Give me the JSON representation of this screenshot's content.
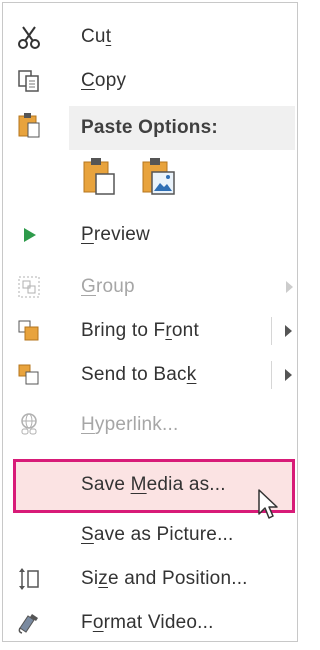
{
  "menu": {
    "items": [
      {
        "pre": "Cu",
        "u": "t",
        "post": "",
        "icon": "scissors-icon",
        "enabled": true
      },
      {
        "pre": "",
        "u": "C",
        "post": "opy",
        "icon": "copy-icon",
        "enabled": true
      },
      {
        "pre": "",
        "u": "P",
        "post": "review",
        "icon": "play-icon",
        "enabled": true
      },
      {
        "pre": "",
        "u": "G",
        "post": "roup",
        "icon": "group-icon",
        "enabled": false
      },
      {
        "pre": "Bring to F",
        "u": "r",
        "post": "ont",
        "icon": "bring-to-front-icon",
        "enabled": true
      },
      {
        "pre": "Send to Bac",
        "u": "k",
        "post": "",
        "icon": "send-to-back-icon",
        "enabled": true
      },
      {
        "pre": "",
        "u": "H",
        "post": "yperlink...",
        "icon": "hyperlink-icon",
        "enabled": false
      },
      {
        "pre": "Save ",
        "u": "M",
        "post": "edia as...",
        "icon": "",
        "enabled": true
      },
      {
        "pre": "",
        "u": "S",
        "post": "ave as Picture...",
        "icon": "",
        "enabled": true
      },
      {
        "pre": "Si",
        "u": "z",
        "post": "e and Position...",
        "icon": "size-position-icon",
        "enabled": true
      },
      {
        "pre": "F",
        "u": "o",
        "post": "rmat Video...",
        "icon": "format-video-icon",
        "enabled": true
      }
    ],
    "paste_header": "Paste Options:",
    "paste_buttons": [
      "paste-keep-source-icon",
      "paste-picture-icon"
    ]
  },
  "colors": {
    "highlight_border": "#d81b78",
    "highlight_fill": "#fbe3e3",
    "play_green": "#2e9b4b",
    "clipboard_orange": "#e8a33d"
  }
}
